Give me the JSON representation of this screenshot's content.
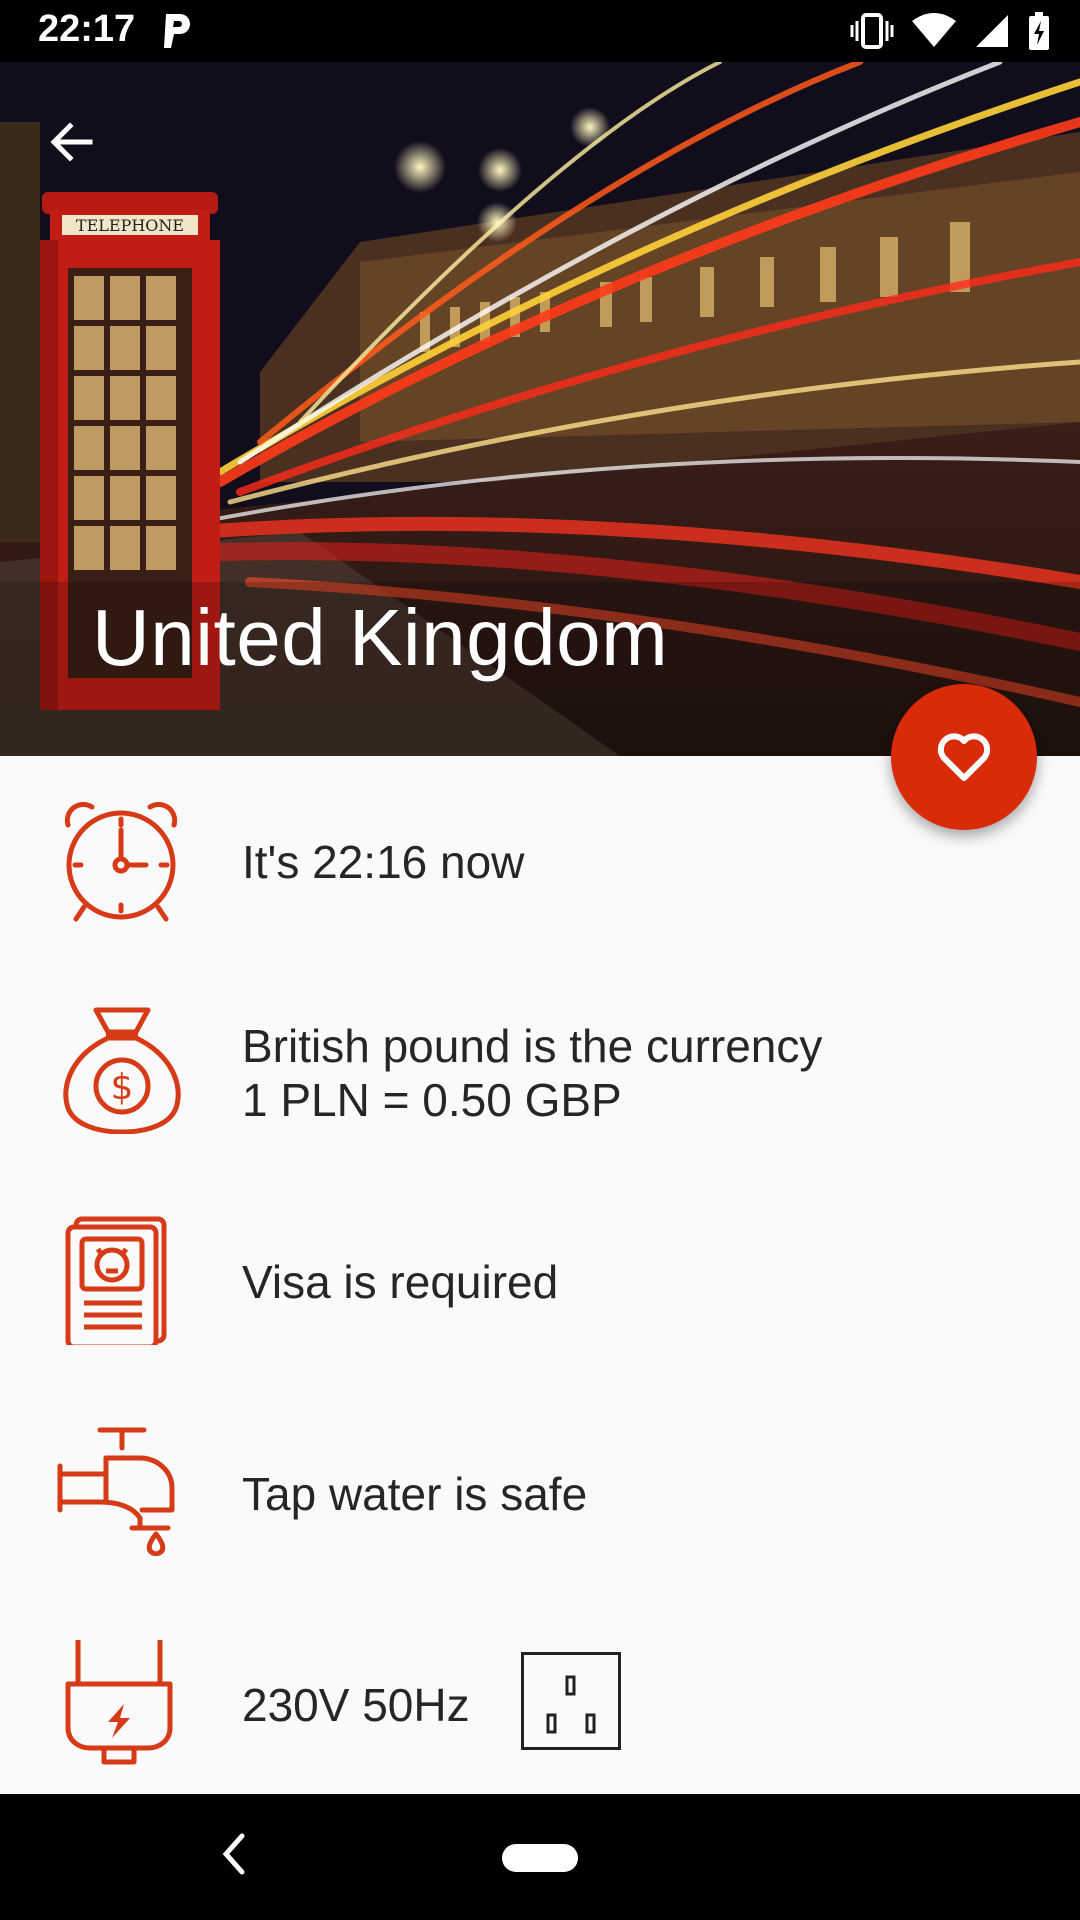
{
  "status_bar": {
    "time": "22:17"
  },
  "hero": {
    "title": "United Kingdom",
    "booth_sign": "TELEPHONE"
  },
  "info": {
    "time_text": "It's 22:16 now",
    "currency_line1": "British pound is the currency",
    "currency_line2": "1 PLN = 0.50 GBP",
    "visa_text": "Visa is required",
    "water_text": "Tap water is safe",
    "power_text": "230V 50Hz"
  },
  "colors": {
    "accent": "#d92b0a",
    "icon": "#d63a17",
    "text": "#262626",
    "background": "#fafafa"
  },
  "icons": [
    "back-arrow-icon",
    "heart-icon",
    "alarm-clock-icon",
    "money-bag-icon",
    "passport-icon",
    "tap-water-icon",
    "plug-icon",
    "uk-socket-icon"
  ]
}
